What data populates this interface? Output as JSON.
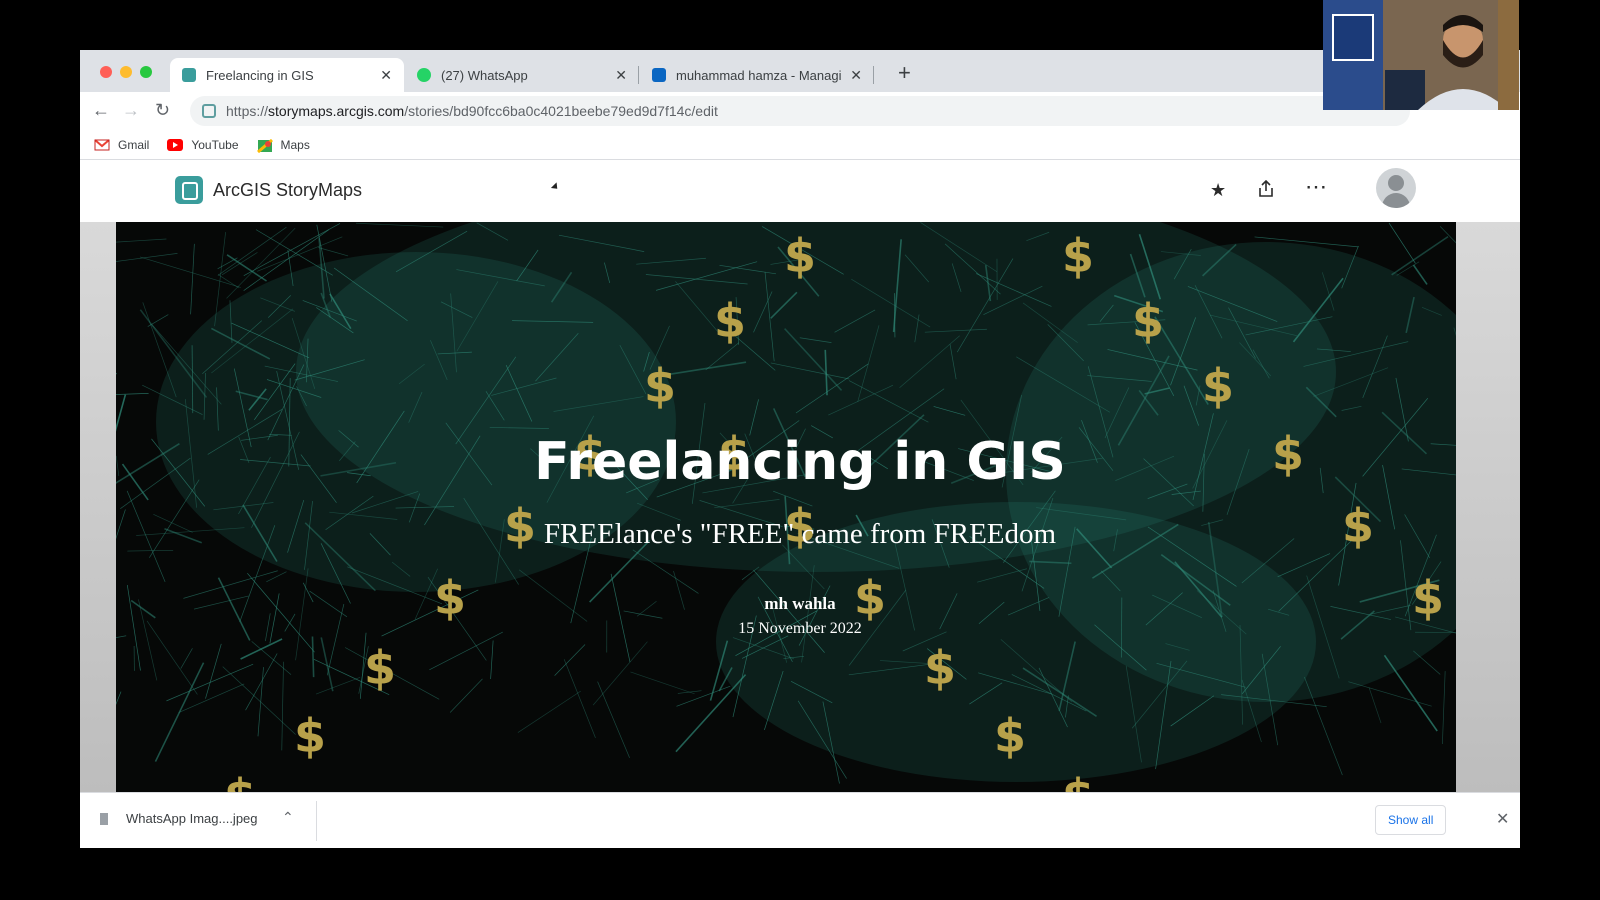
{
  "browser": {
    "tabs": [
      {
        "title": "Freelancing in GIS",
        "active": true
      },
      {
        "title": "(27) WhatsApp",
        "active": false
      },
      {
        "title": "muhammad hamza - Managing",
        "active": false
      }
    ],
    "url_prefix": "https://",
    "url_host": "storymaps.arcgis.com",
    "url_path": "/stories/bd90fcc6ba0c4021beebe79ed9d7f14c/edit",
    "bookmarks": [
      {
        "label": "Gmail",
        "icon": "gmail-icon"
      },
      {
        "label": "YouTube",
        "icon": "youtube-icon"
      },
      {
        "label": "Maps",
        "icon": "maps-icon"
      }
    ]
  },
  "storymaps": {
    "brand": "ArcGIS StoryMaps",
    "header_icons": [
      "star-icon",
      "share-icon",
      "more-icon",
      "avatar"
    ]
  },
  "hero": {
    "title": "Freelancing in GIS",
    "subtitle": "FREElance's \"FREE\" came from FREEdom",
    "author": "mh wahla",
    "date": "15 November 2022",
    "symbol": "$",
    "symbol_color": "#b8a14a",
    "map_color": "#2f8a78"
  },
  "downloads": {
    "file": "WhatsApp Imag....jpeg",
    "show_all": "Show all"
  }
}
